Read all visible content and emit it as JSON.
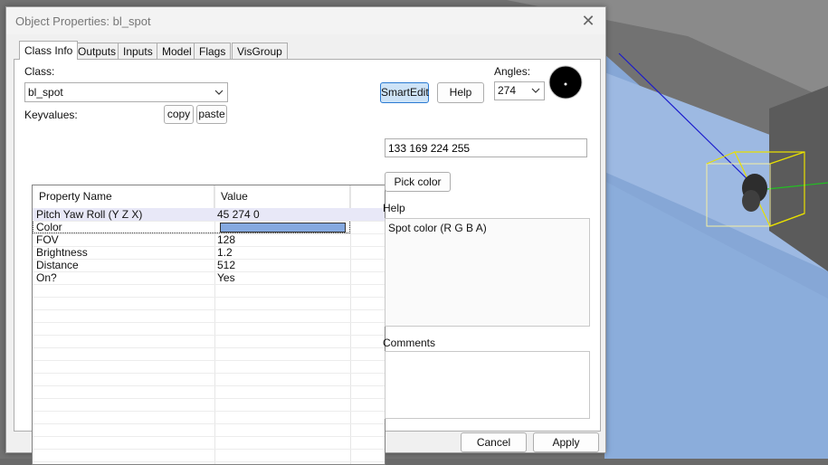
{
  "window": {
    "title": "Object Properties: bl_spot"
  },
  "tabs": [
    {
      "label": "Class Info",
      "active": true
    },
    {
      "label": "Outputs"
    },
    {
      "label": "Inputs"
    },
    {
      "label": "Model"
    },
    {
      "label": "Flags"
    },
    {
      "label": "VisGroup"
    }
  ],
  "class_info": {
    "class_label": "Class:",
    "class_value": "bl_spot",
    "keyvalues_label": "Keyvalues:",
    "copy_label": "copy",
    "paste_label": "paste",
    "smartedit_label": "SmartEdit",
    "help_button_label": "Help",
    "angles_label": "Angles:",
    "angles_value": "274"
  },
  "property_list": {
    "columns": [
      "Property Name",
      "Value"
    ],
    "rows": [
      {
        "name": "Pitch Yaw Roll (Y Z X)",
        "value": "45 274 0"
      },
      {
        "name": "Color",
        "value": "",
        "selected": true
      },
      {
        "name": "FOV",
        "value": "128"
      },
      {
        "name": "Brightness",
        "value": "1.2"
      },
      {
        "name": "Distance",
        "value": "512"
      },
      {
        "name": "On?",
        "value": "Yes"
      }
    ]
  },
  "editor": {
    "value": "133 169 224 255",
    "pick_color_label": "Pick color",
    "help_label": "Help",
    "help_text": "Spot color (R G B A)",
    "comments_label": "Comments",
    "comments_text": ""
  },
  "footer": {
    "cancel_label": "Cancel",
    "apply_label": "Apply"
  },
  "colors": {
    "spot_color": "#85a9e0",
    "accent": "#2a7ad2"
  }
}
